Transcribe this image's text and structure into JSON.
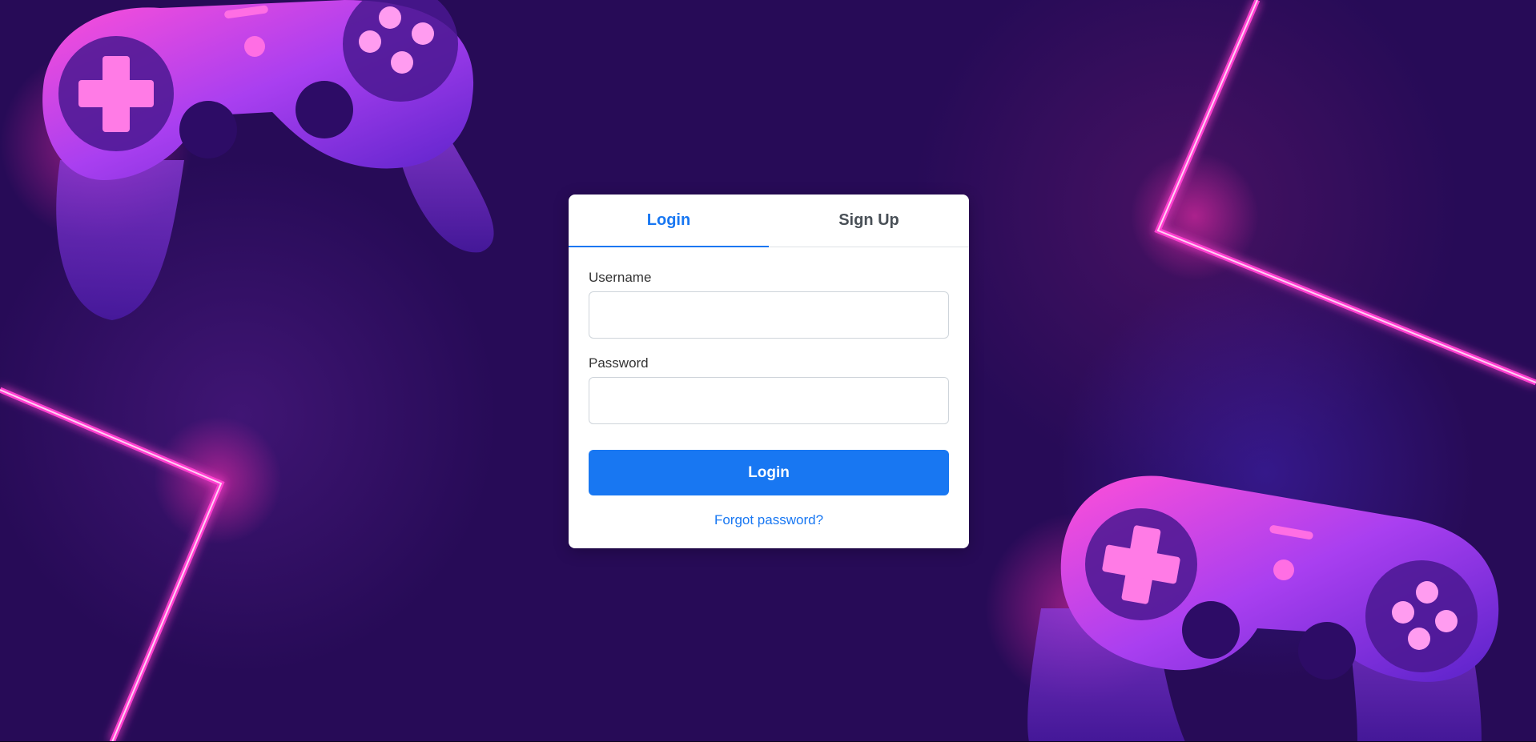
{
  "colors": {
    "accent": "#1877f2",
    "background": "#270b57",
    "neon_pink": "#ff3fd0",
    "neon_purple": "#7a3cff"
  },
  "background_art": {
    "icons": [
      "gamepad-icon",
      "gamepad-icon"
    ]
  },
  "auth": {
    "tabs": [
      {
        "label": "Login",
        "active": true
      },
      {
        "label": "Sign Up",
        "active": false
      }
    ],
    "username": {
      "label": "Username",
      "value": "",
      "placeholder": ""
    },
    "password": {
      "label": "Password",
      "value": "",
      "placeholder": ""
    },
    "submit_label": "Login",
    "forgot_label": "Forgot password?"
  }
}
